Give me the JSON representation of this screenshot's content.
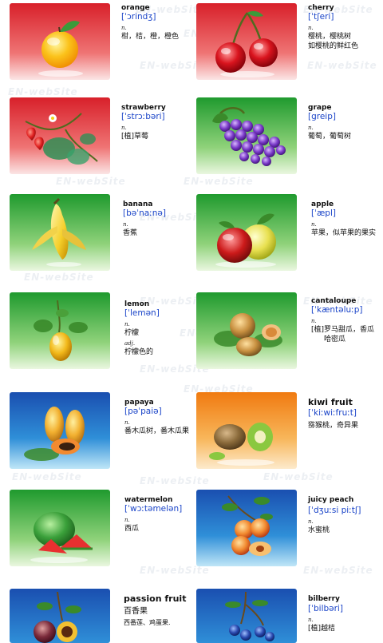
{
  "watermark": "EN-webSite",
  "fruits": [
    {
      "word": "orange",
      "ipa": "[ˈɔrindʒ]",
      "pos": "n.",
      "meaning": "柑，桔，橙，橙色",
      "bg": "red"
    },
    {
      "word": "cherry",
      "ipa": "[ˈtʃeri]",
      "pos": "n.",
      "meaning": "樱桃，樱桃树",
      "meaning2": "如樱桃的鲜红色",
      "bg": "red"
    },
    {
      "word": "strawberry",
      "ipa": "[ˈstrɔːbəri]",
      "pos": "n.",
      "meaning": "[植]草莓",
      "bg": "red"
    },
    {
      "word": "grape",
      "ipa": "[greip]",
      "pos": "n.",
      "meaning": "葡萄，葡萄树",
      "bg": "green"
    },
    {
      "word": "banana",
      "ipa": "[bəˈnaːnə]",
      "pos": "n.",
      "meaning": "香蕉",
      "bg": "green"
    },
    {
      "word": "apple",
      "ipa": "[ˈæpl]",
      "pos": "n.",
      "meaning": "苹果，似苹果的果实",
      "bg": "green"
    },
    {
      "word": "lemon",
      "ipa": "[ˈlemən]",
      "pos": "n.",
      "meaning": "柠檬",
      "pos2": "adj.",
      "meaning2": "柠檬色的",
      "bg": "green"
    },
    {
      "word": "cantaloupe",
      "ipa": "[ˈkæntəluːp]",
      "pos": "n.",
      "meaning": "[植]罗马甜瓜，香瓜",
      "meaning2": "哈密瓜",
      "bg": "green"
    },
    {
      "word": "papaya",
      "ipa": "[pəˈpaiə]",
      "pos": "n.",
      "meaning": "番木瓜树，番木瓜果",
      "bg": "blue"
    },
    {
      "word": "kiwi fruit",
      "ipa": "[ˈkiːwiːfruːt]",
      "meaning": "猕猴桃，奇异果",
      "bg": "orange"
    },
    {
      "word": "watermelon",
      "ipa": "[ˈwɔːtəmelən]",
      "pos": "n.",
      "meaning": "西瓜",
      "bg": "green"
    },
    {
      "word": "juicy peach",
      "ipa": "[ˈdʒuːsi piːtʃ]",
      "pos": "n.",
      "meaning": "水蜜桃",
      "bg": "blue"
    },
    {
      "word": "passion fruit",
      "meaning": "百香果",
      "meaning2": "西番莲、鸡蛋果.",
      "bg": "blue"
    },
    {
      "word": "bilberry",
      "ipa": "[ˈbilbəri]",
      "pos": "n.",
      "meaning": "[植]越桔",
      "bg": "blue"
    }
  ]
}
